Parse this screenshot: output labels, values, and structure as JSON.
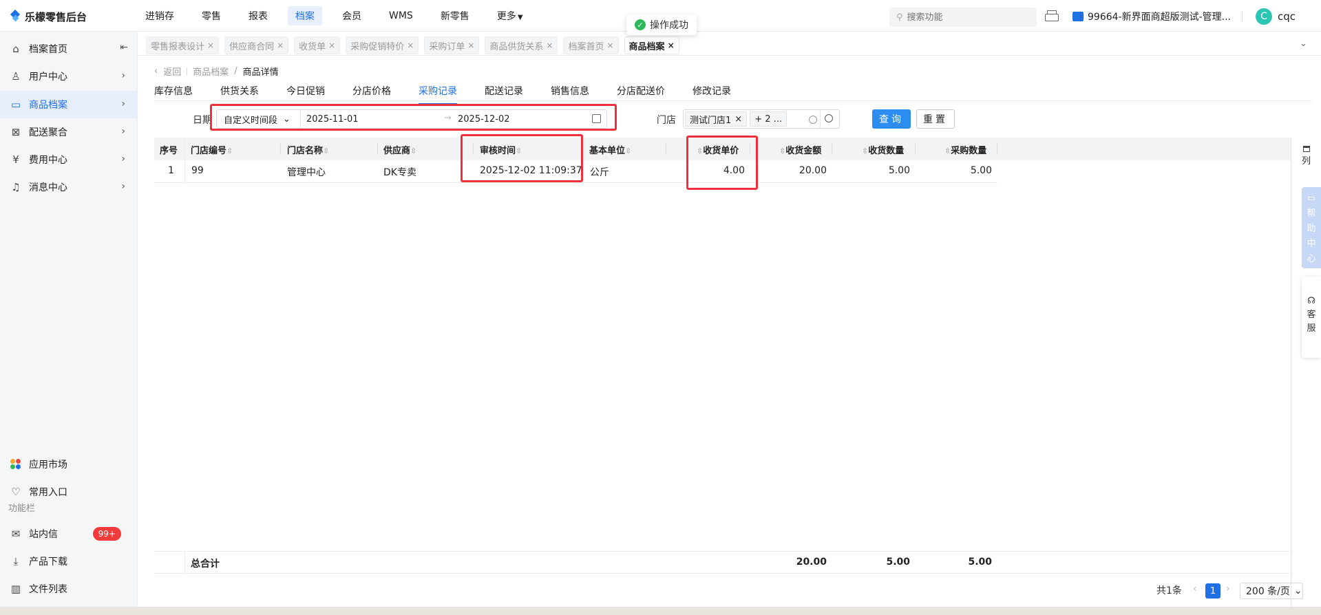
{
  "app": {
    "logo": "乐檬零售后台"
  },
  "topnav": [
    "进销存",
    "零售",
    "报表",
    "档案",
    "会员",
    "WMS",
    "新零售",
    "更多"
  ],
  "topnav_active": 3,
  "toast": "操作成功",
  "search": {
    "placeholder": "搜索功能"
  },
  "store_name": "99664-新界面商超版测试-管理...",
  "user": {
    "initial": "C",
    "name": "cqc"
  },
  "sidebar": {
    "items": [
      {
        "label": "档案首页",
        "icon": "home-icon",
        "glyph": "⌂"
      },
      {
        "label": "用户中心",
        "icon": "user-icon",
        "glyph": "♙"
      },
      {
        "label": "商品档案",
        "icon": "product-icon",
        "glyph": "▭"
      },
      {
        "label": "配送聚合",
        "icon": "delivery-icon",
        "glyph": "⊠"
      },
      {
        "label": "费用中心",
        "icon": "yen-icon",
        "glyph": "¥"
      },
      {
        "label": "消息中心",
        "icon": "bell-icon",
        "glyph": "♫"
      }
    ],
    "active": 2,
    "app_market": "应用市场",
    "common_entry": "常用入口",
    "function_bar_title": "功能栏",
    "inbox": "站内信",
    "inbox_badge": "99+",
    "product_download": "产品下载",
    "file_list": "文件列表"
  },
  "tabs": [
    {
      "label": "零售报表设计",
      "close": "×"
    },
    {
      "label": "供应商合同",
      "close": "×"
    },
    {
      "label": "收货单",
      "close": "×"
    },
    {
      "label": "采购促销特价",
      "close": "×"
    },
    {
      "label": "采购订单",
      "close": "×"
    },
    {
      "label": "商品供货关系",
      "close": "×"
    },
    {
      "label": "档案首页",
      "close": "×"
    },
    {
      "label": "商品档案",
      "close": "×"
    }
  ],
  "breadcrumb": {
    "back": "返回",
    "parent": "商品档案",
    "sep": "/",
    "current": "商品详情"
  },
  "subtabs": [
    "库存信息",
    "供货关系",
    "今日促销",
    "分店价格",
    "采购记录",
    "配送记录",
    "销售信息",
    "分店配送价",
    "修改记录"
  ],
  "subtabs_active": 4,
  "filter": {
    "date_label": "日期",
    "date_mode": "自定义时间段",
    "date_start": "2025-11-01",
    "date_arrow": "→",
    "date_end": "2025-12-02",
    "store_label": "门店",
    "store_tag": "测试门店1",
    "store_more": "+ 2 ...",
    "query": "查询",
    "reset": "重置"
  },
  "table": {
    "headers": [
      "序号",
      "门店编号",
      "门店名称",
      "供应商",
      "审核时间",
      "基本单位",
      "收货单价",
      "收货金额",
      "收货数量",
      "采购数量"
    ],
    "rows": [
      [
        "1",
        "99",
        "管理中心",
        "DK专卖",
        "2025-12-02 11:09:37",
        "公斤",
        "4.00",
        "20.00",
        "5.00",
        "5.00"
      ]
    ],
    "footer_label": "总合计",
    "footer": {
      "amount": "20.00",
      "received_qty": "5.00",
      "purchase_qty": "5.00"
    },
    "column_btn": "列"
  },
  "help": [
    "帮",
    "助",
    "中",
    "心"
  ],
  "service": [
    "客",
    "服"
  ],
  "pagination": {
    "total": "共1条",
    "prev": "‹",
    "page": "1",
    "next": "›",
    "size": "200 条/页"
  }
}
